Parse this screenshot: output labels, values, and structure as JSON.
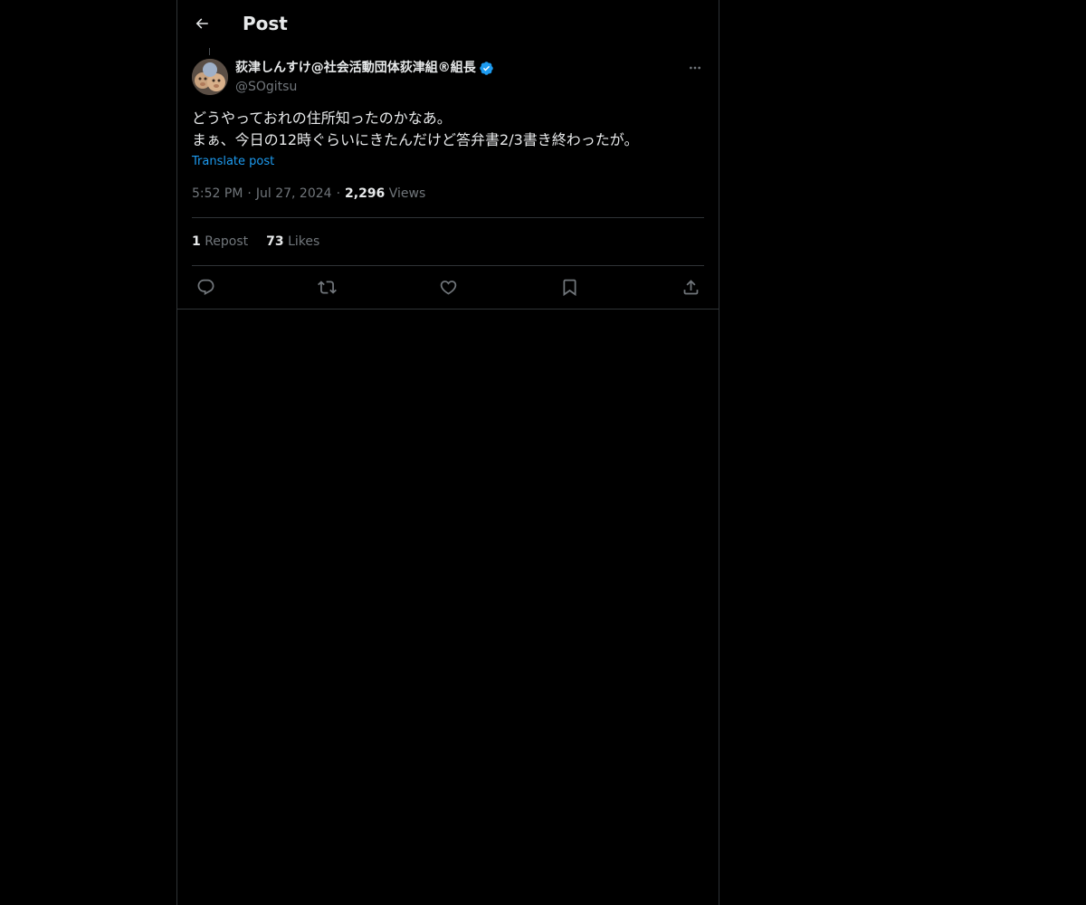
{
  "header": {
    "title": "Post",
    "back_icon": "arrow-left-icon"
  },
  "author": {
    "name": "荻津しんすけ@社会活動団体荻津組®組長",
    "handle": "@SOgitsu",
    "verified": true,
    "verified_color": "#1d9bf0"
  },
  "tweet": {
    "text": "どうやっておれの住所知ったのかなあ。\nまぁ、今日の12時ぐらいにきたんだけど答弁書2/3書き終わったが。",
    "translate_label": "Translate post",
    "time": "5:52 PM",
    "date": "Jul 27, 2024",
    "views_count": "2,296",
    "views_label": "Views"
  },
  "stats": {
    "reposts_count": "1",
    "reposts_label": "Repost",
    "likes_count": "73",
    "likes_label": "Likes"
  },
  "actions": [
    "reply-icon",
    "repost-icon",
    "like-icon",
    "bookmark-icon",
    "share-icon"
  ],
  "colors": {
    "background": "#000000",
    "text": "#e7e9ea",
    "secondary": "#71767b",
    "accent": "#1d9bf0",
    "border": "#2f3336"
  }
}
